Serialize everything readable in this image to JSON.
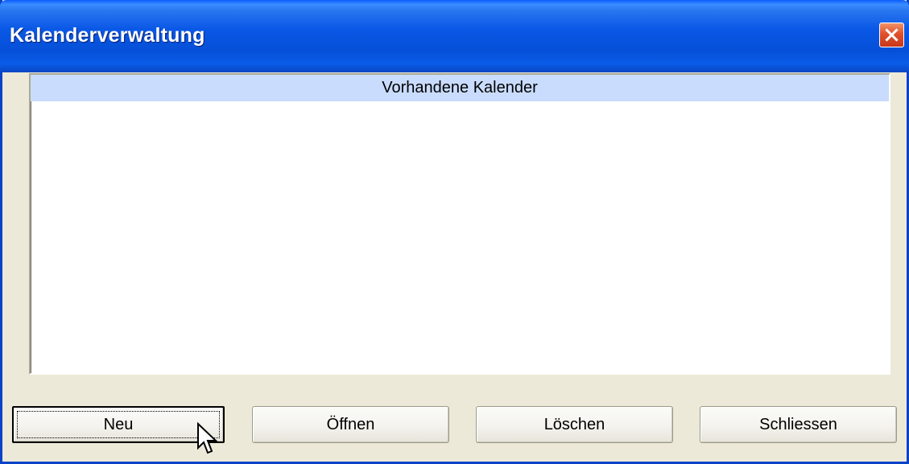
{
  "window": {
    "title": "Kalenderverwaltung",
    "close_icon": "close-icon"
  },
  "list": {
    "header": "Vorhandene Kalender",
    "items": []
  },
  "buttons": {
    "neu": "Neu",
    "oeffnen": "Öffnen",
    "loeschen": "Löschen",
    "schliessen": "Schliessen"
  },
  "cursor": {
    "icon": "mouse-pointer-icon"
  },
  "colors": {
    "titlebar": "#0a58e6",
    "close_button": "#e0512c",
    "list_header": "#c9dcfd",
    "dialog_background": "#ece9d8"
  }
}
